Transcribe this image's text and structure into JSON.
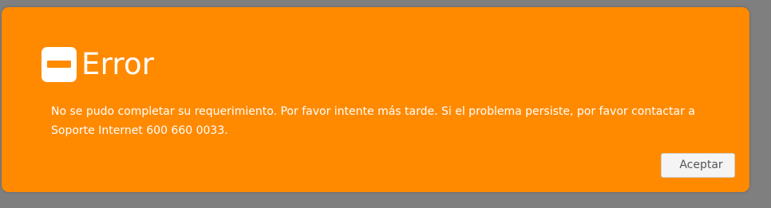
{
  "dialog": {
    "title": "Error",
    "icon": "minus-icon",
    "message": "No se pudo completar su requerimiento. Por favor intente más tarde. Si el problema persiste, por favor contactar a Soporte Internet 600 660 0033.",
    "accept_label": "Aceptar"
  },
  "colors": {
    "dialog_background": "#ff8a00",
    "overlay": "#7f7f7f",
    "text": "#ffffff",
    "button_background": "#f4f4f4"
  }
}
